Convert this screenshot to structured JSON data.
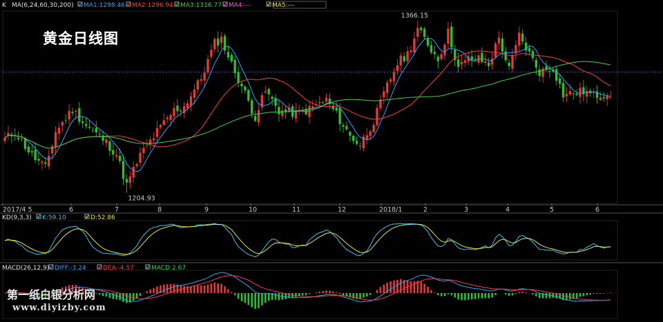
{
  "chart_data": {
    "type": "candlestick",
    "title": "黄金日线图",
    "price_panel": {
      "header_prefix": "K",
      "indicator": "MA(6,24,60,30,200)",
      "ma_legend": [
        {
          "label": "MA1:1298.46",
          "color": "#2aa6ff"
        },
        {
          "label": "MA2:1296.94",
          "color": "#ff3b3b"
        },
        {
          "label": "MA3:1316.77",
          "color": "#3cd24a"
        },
        {
          "label": "MA4:---",
          "color": "#ff4fd8"
        },
        {
          "label": "MA5:---",
          "color": "#e8e83a"
        }
      ],
      "high_label": "1366.15",
      "low_label": "1204.93",
      "high_value": 1366.15,
      "low_value": 1204.93,
      "reference_level": 1318
    },
    "x_ticks": [
      "2017/4 5",
      "6",
      "7",
      "8",
      "9",
      "10",
      "11",
      "12",
      "2018/1",
      "2",
      "3",
      "4",
      "5",
      "6"
    ],
    "close_anchors": [
      {
        "bar": 0,
        "close": 1255
      },
      {
        "bar": 3,
        "close": 1262
      },
      {
        "bar": 8,
        "close": 1240
      },
      {
        "bar": 12,
        "close": 1228
      },
      {
        "bar": 15,
        "close": 1262
      },
      {
        "bar": 20,
        "close": 1283
      },
      {
        "bar": 24,
        "close": 1268
      },
      {
        "bar": 30,
        "close": 1252
      },
      {
        "bar": 33,
        "close": 1241
      },
      {
        "bar": 36,
        "close": 1212
      },
      {
        "bar": 40,
        "close": 1240
      },
      {
        "bar": 45,
        "close": 1262
      },
      {
        "bar": 50,
        "close": 1282
      },
      {
        "bar": 53,
        "close": 1286
      },
      {
        "bar": 58,
        "close": 1312
      },
      {
        "bar": 62,
        "close": 1345
      },
      {
        "bar": 64,
        "close": 1349
      },
      {
        "bar": 67,
        "close": 1325
      },
      {
        "bar": 70,
        "close": 1305
      },
      {
        "bar": 74,
        "close": 1276
      },
      {
        "bar": 77,
        "close": 1300
      },
      {
        "bar": 81,
        "close": 1282
      },
      {
        "bar": 86,
        "close": 1279
      },
      {
        "bar": 90,
        "close": 1283
      },
      {
        "bar": 95,
        "close": 1292
      },
      {
        "bar": 98,
        "close": 1278
      },
      {
        "bar": 102,
        "close": 1258
      },
      {
        "bar": 105,
        "close": 1250
      },
      {
        "bar": 109,
        "close": 1272
      },
      {
        "bar": 113,
        "close": 1305
      },
      {
        "bar": 116,
        "close": 1326
      },
      {
        "bar": 119,
        "close": 1335
      },
      {
        "bar": 122,
        "close": 1358
      },
      {
        "bar": 125,
        "close": 1344
      },
      {
        "bar": 128,
        "close": 1330
      },
      {
        "bar": 131,
        "close": 1355
      },
      {
        "bar": 134,
        "close": 1322
      },
      {
        "bar": 137,
        "close": 1330
      },
      {
        "bar": 140,
        "close": 1330
      },
      {
        "bar": 143,
        "close": 1325
      },
      {
        "bar": 146,
        "close": 1350
      },
      {
        "bar": 149,
        "close": 1320
      },
      {
        "bar": 152,
        "close": 1352
      },
      {
        "bar": 155,
        "close": 1335
      },
      {
        "bar": 158,
        "close": 1318
      },
      {
        "bar": 162,
        "close": 1322
      },
      {
        "bar": 165,
        "close": 1297
      },
      {
        "bar": 168,
        "close": 1298
      },
      {
        "bar": 171,
        "close": 1300
      },
      {
        "bar": 174,
        "close": 1296
      },
      {
        "bar": 178,
        "close": 1298
      }
    ],
    "kd_panel": {
      "label": "KD(9,3,3)",
      "legend": [
        {
          "label": "K:59.10",
          "color": "#35c8f0"
        },
        {
          "label": "D:52.86",
          "color": "#e8e83a"
        }
      ]
    },
    "macd_panel": {
      "label": "MACD(26,12,9)",
      "legend": [
        {
          "label": "DIFF:-3.24",
          "color": "#2aa6ff"
        },
        {
          "label": "DEA:-4.57",
          "color": "#ff3b3b"
        },
        {
          "label": "MACD:2.67",
          "color": "#3cd24a"
        }
      ]
    },
    "colors": {
      "up": "#e23a3a",
      "down": "#2fbe2f",
      "grid": "#3a3a3a",
      "reference": "#6a6ac8",
      "kd_k": "#35c8f0",
      "kd_d": "#e8e83a",
      "macd_diff": "#2aa6ff",
      "macd_dea": "#ff3b3b",
      "macd_pos": "#e23a3a",
      "macd_neg": "#2fbe2f"
    }
  },
  "watermark": {
    "line1": "第一纸白银分析网",
    "line2": "www.diyizby.com"
  }
}
